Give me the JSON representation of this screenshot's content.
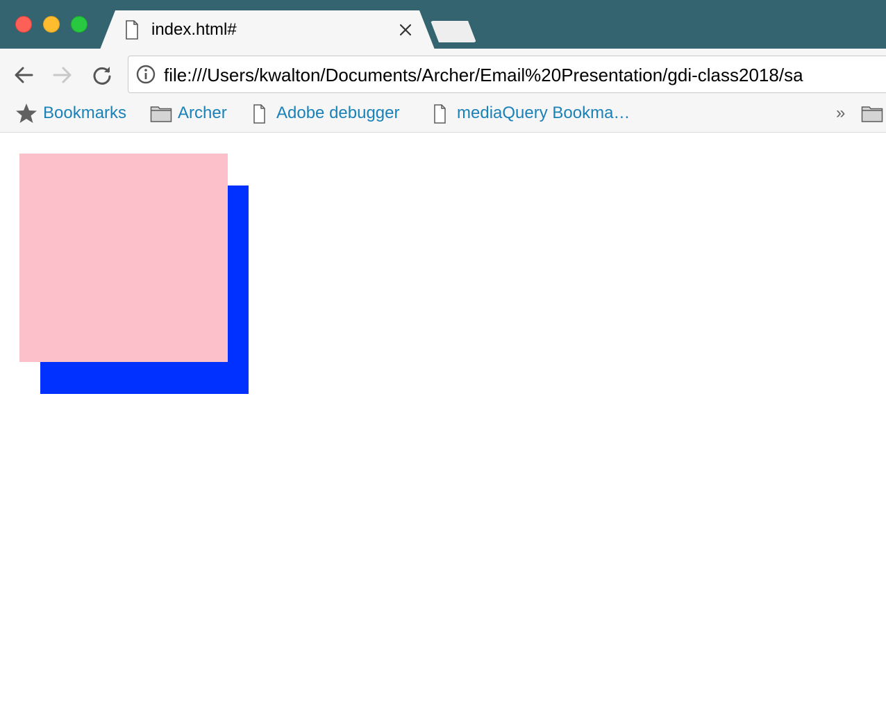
{
  "colors": {
    "titlebar": "#33646f",
    "link": "#1a82b8",
    "pink_box": "#fcc0cb",
    "blue_box": "#0031ff"
  },
  "tab": {
    "title": "index.html#",
    "icon": "document-icon",
    "close_icon": "close-icon"
  },
  "toolbar": {
    "back_icon": "back-arrow-icon",
    "forward_icon": "forward-arrow-icon",
    "reload_icon": "reload-icon",
    "info_icon": "info-icon",
    "url": "file:///Users/kwalton/Documents/Archer/Email%20Presentation/gdi-class2018/sa"
  },
  "bookmarks": {
    "items": [
      {
        "label": "Bookmarks",
        "icon": "star-icon"
      },
      {
        "label": "Archer",
        "icon": "folder-icon"
      },
      {
        "label": "Adobe debugger",
        "icon": "document-icon"
      },
      {
        "label": "mediaQuery Bookma…",
        "icon": "document-icon"
      }
    ],
    "overflow": "»",
    "overflow_folder_icon": "folder-icon"
  }
}
